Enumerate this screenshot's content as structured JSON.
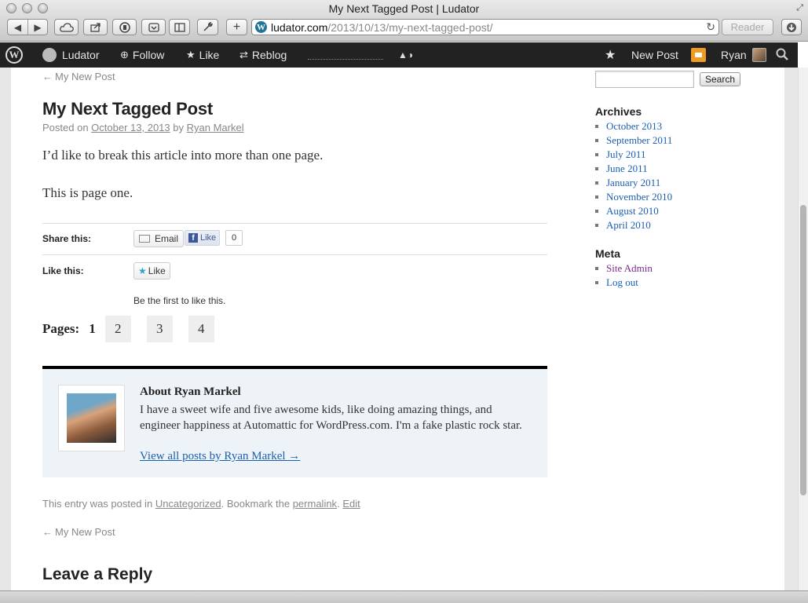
{
  "window": {
    "title": "My Next Tagged Post | Ludator"
  },
  "toolbar": {
    "url_host": "ludator.com",
    "url_path": "/2013/10/13/my-next-tagged-post/",
    "reader_label": "Reader"
  },
  "adminbar": {
    "site_name": "Ludator",
    "follow_label": "Follow",
    "like_label": "Like",
    "reblog_label": "Reblog",
    "new_post_label": "New Post",
    "user_name": "Ryan"
  },
  "post": {
    "prev_link_top": "My New Post",
    "title": "My Next Tagged Post",
    "posted_on_prefix": "Posted on",
    "date": "October 13, 2013",
    "by": "by",
    "author": "Ryan Markel",
    "paragraphs": [
      "I’d like to break this article into more than one page.",
      "This is page one."
    ]
  },
  "sharing": {
    "share_label": "Share this:",
    "email_label": "Email",
    "fb_like_label": "Like",
    "fb_count": "0",
    "like_label": "Like this:",
    "like_button": "Like",
    "first_to_like": "Be the first to like this."
  },
  "pagination": {
    "label": "Pages:",
    "current": "1",
    "pages": [
      "2",
      "3",
      "4"
    ]
  },
  "author_box": {
    "heading": "About Ryan Markel",
    "bio": "I have a sweet wife and five awesome kids, like doing amazing things, and engineer happiness at Automattic for WordPress.com. I'm a fake plastic rock star.",
    "link": "View all posts by Ryan Markel →"
  },
  "entry_meta": {
    "prefix": "This entry was posted in",
    "category": "Uncategorized",
    "middle": ". Bookmark the",
    "permalink": "permalink",
    "sep": ".",
    "edit": "Edit"
  },
  "prev_link_bottom": "My New Post",
  "reply_title": "Leave a Reply",
  "sidebar": {
    "search_button": "Search",
    "archives_title": "Archives",
    "archives": [
      "October 2013",
      "September 2011",
      "July 2011",
      "June 2011",
      "January 2011",
      "November 2010",
      "August 2010",
      "April 2010"
    ],
    "meta_title": "Meta",
    "meta": [
      "Site Admin",
      "Log out"
    ]
  }
}
